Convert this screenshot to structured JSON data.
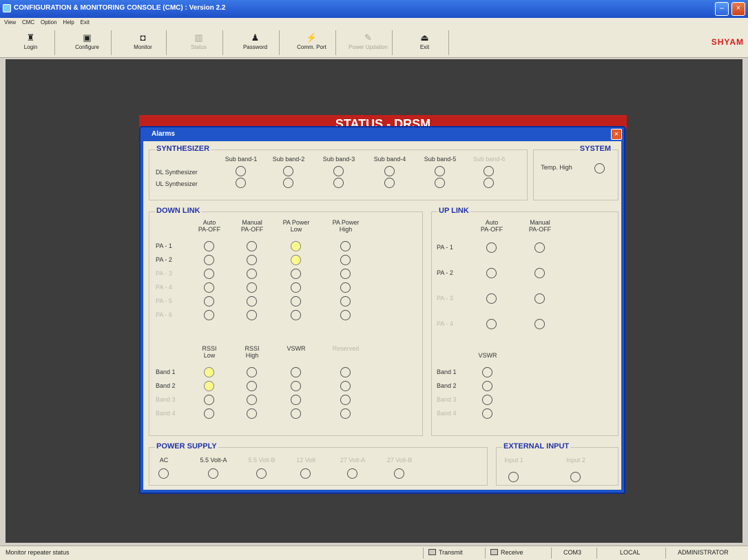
{
  "window": {
    "title": "CONFIGURATION & MONITORING CONSOLE (CMC) : Version 2.2",
    "min": "–",
    "close": "×"
  },
  "menu": [
    "View",
    "CMC",
    "Option",
    "Help",
    "Exit"
  ],
  "toolbar": [
    {
      "label": "Login",
      "icon": "login-icon",
      "glyph": "♜",
      "enabled": true
    },
    {
      "label": "Configure",
      "icon": "configure-icon",
      "glyph": "▣",
      "enabled": true
    },
    {
      "label": "Monitor",
      "icon": "monitor-icon",
      "glyph": "◘",
      "enabled": true
    },
    {
      "label": "Status",
      "icon": "status-icon",
      "glyph": "▥",
      "enabled": false
    },
    {
      "label": "Password",
      "icon": "password-icon",
      "glyph": "♟",
      "enabled": true
    },
    {
      "label": "Comm. Port",
      "icon": "comm-port-icon",
      "glyph": "⚡",
      "enabled": true
    },
    {
      "label": "Power Updation",
      "icon": "power-updation-icon",
      "glyph": "✎",
      "enabled": false
    },
    {
      "label": "Exit",
      "icon": "exit-icon",
      "glyph": "⏏",
      "enabled": true
    }
  ],
  "brand": "SHYAM",
  "banner": "STATUS - DRSM",
  "alarms": {
    "title": "Alarms",
    "close": "×",
    "synth": {
      "title": "SYNTHESIZER",
      "cols": [
        "Sub band-1",
        "Sub band-2",
        "Sub band-3",
        "Sub band-4",
        "Sub band-5",
        "Sub band-6"
      ],
      "rows": [
        "DL Synthesizer",
        "UL Synthesizer"
      ]
    },
    "system": {
      "title": "SYSTEM",
      "temp": "Temp. High"
    },
    "downlink": {
      "title": "DOWN LINK",
      "pa_cols": [
        "Auto PA-OFF",
        "Manual PA-OFF",
        "PA Power Low",
        "PA Power High"
      ],
      "pa_rows": [
        "PA - 1",
        "PA - 2",
        "PA - 3",
        "PA - 4",
        "PA - 5",
        "PA - 6"
      ],
      "pa_active": [
        [
          0,
          0,
          1,
          0
        ],
        [
          0,
          0,
          1,
          0
        ],
        [
          0,
          0,
          0,
          0
        ],
        [
          0,
          0,
          0,
          0
        ],
        [
          0,
          0,
          0,
          0
        ],
        [
          0,
          0,
          0,
          0
        ]
      ],
      "band_cols": [
        "RSSI Low",
        "RSSI High",
        "VSWR",
        "Reserved"
      ],
      "band_rows": [
        "Band 1",
        "Band 2",
        "Band 3",
        "Band 4"
      ],
      "band_active": [
        [
          1,
          0,
          0,
          0
        ],
        [
          1,
          0,
          0,
          0
        ],
        [
          0,
          0,
          0,
          0
        ],
        [
          0,
          0,
          0,
          0
        ]
      ]
    },
    "uplink": {
      "title": "UP LINK",
      "pa_cols": [
        "Auto PA-OFF",
        "Manual PA-OFF"
      ],
      "pa_rows": [
        "PA - 1",
        "PA - 2",
        "PA - 3",
        "PA - 4"
      ],
      "vswr": "VSWR",
      "band_rows": [
        "Band 1",
        "Band 2",
        "Band 3",
        "Band 4"
      ]
    },
    "power": {
      "title": "POWER SUPPLY",
      "items": [
        "AC",
        "5.5 Volt-A",
        "5.5 Volt-B",
        "12 Volt",
        "27 Volt-A",
        "27 Volt-B"
      ]
    },
    "external": {
      "title": "EXTERNAL INPUT",
      "items": [
        "Input 1",
        "Input 2"
      ]
    }
  },
  "status": {
    "message": "Monitor repeater status",
    "transmit": "Transmit",
    "receive": "Receive",
    "mode": "COM3",
    "location": "LOCAL",
    "user": "ADMINISTRATOR"
  }
}
